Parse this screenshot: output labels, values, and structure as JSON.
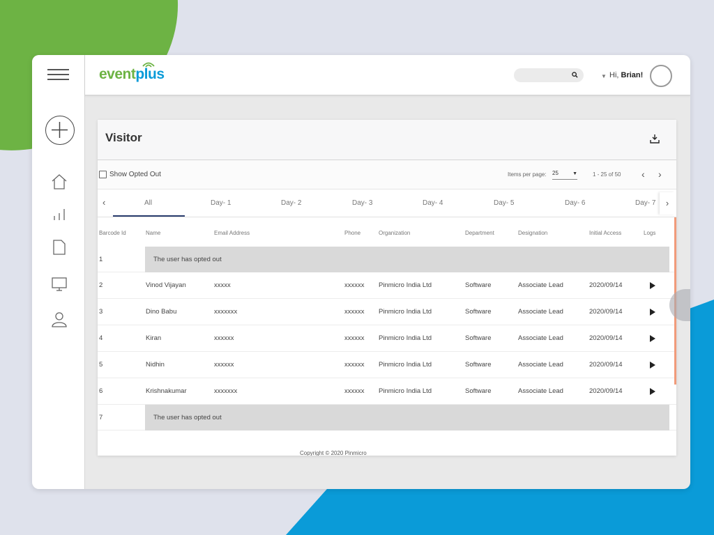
{
  "app": {
    "logo_event": "event",
    "logo_plus": "plus"
  },
  "header": {
    "greeting_prefix": "Hi, ",
    "user_name": "Brian!"
  },
  "sidebar": {
    "icons": [
      "home-icon",
      "analytics-icon",
      "document-icon",
      "monitor-icon",
      "user-icon"
    ]
  },
  "card": {
    "title": "Visitor"
  },
  "toolbar": {
    "show_opted_out_label": "Show Opted Out",
    "items_per_page_label": "Items per page:",
    "items_per_page_value": "25",
    "range_text": "1 - 25 of 50"
  },
  "tabs": [
    {
      "label": "All",
      "active": true
    },
    {
      "label": "Day- 1"
    },
    {
      "label": "Day- 2"
    },
    {
      "label": "Day- 3"
    },
    {
      "label": "Day- 4"
    },
    {
      "label": "Day- 5"
    },
    {
      "label": "Day- 6"
    },
    {
      "label": "Day- 7"
    }
  ],
  "table": {
    "columns": [
      "Barcode Id",
      "Name",
      "Email Address",
      "Phone",
      "Organization",
      "Department",
      "Designation",
      "Initial Access",
      "Logs"
    ],
    "rows": [
      {
        "id": "1",
        "opted_out": "The user has opted out"
      },
      {
        "id": "2",
        "name": "Vinod Vijayan",
        "email": "xxxxx",
        "phone": "xxxxxx",
        "org": "Pinmicro India Ltd",
        "dept": "Software",
        "designation": "Associate Lead",
        "access": "2020/09/14"
      },
      {
        "id": "3",
        "name": "Dino Babu",
        "email": "xxxxxxx",
        "phone": "xxxxxx",
        "org": "Pinmicro India Ltd",
        "dept": "Software",
        "designation": "Associate Lead",
        "access": "2020/09/14"
      },
      {
        "id": "4",
        "name": "Kiran",
        "email": "xxxxxx",
        "phone": "xxxxxx",
        "org": "Pinmicro India Ltd",
        "dept": "Software",
        "designation": "Associate Lead",
        "access": "2020/09/14"
      },
      {
        "id": "5",
        "name": "Nidhin",
        "email": "xxxxxx",
        "phone": "xxxxxx",
        "org": "Pinmicro India Ltd",
        "dept": "Software",
        "designation": "Associate Lead",
        "access": "2020/09/14"
      },
      {
        "id": "6",
        "name": "Krishnakumar",
        "email": "xxxxxxx",
        "phone": "xxxxxx",
        "org": "Pinmicro India Ltd",
        "dept": "Software",
        "designation": "Associate Lead",
        "access": "2020/09/14"
      },
      {
        "id": "7",
        "opted_out": "The user has opted out"
      }
    ]
  },
  "footer": {
    "copyright": "Copyright © 2020 Pinmicro"
  },
  "colors": {
    "brand_green": "#6db344",
    "brand_blue": "#0a9bd8",
    "tab_active": "#2a3d6e",
    "scroll_accent": "#f19b7a"
  }
}
